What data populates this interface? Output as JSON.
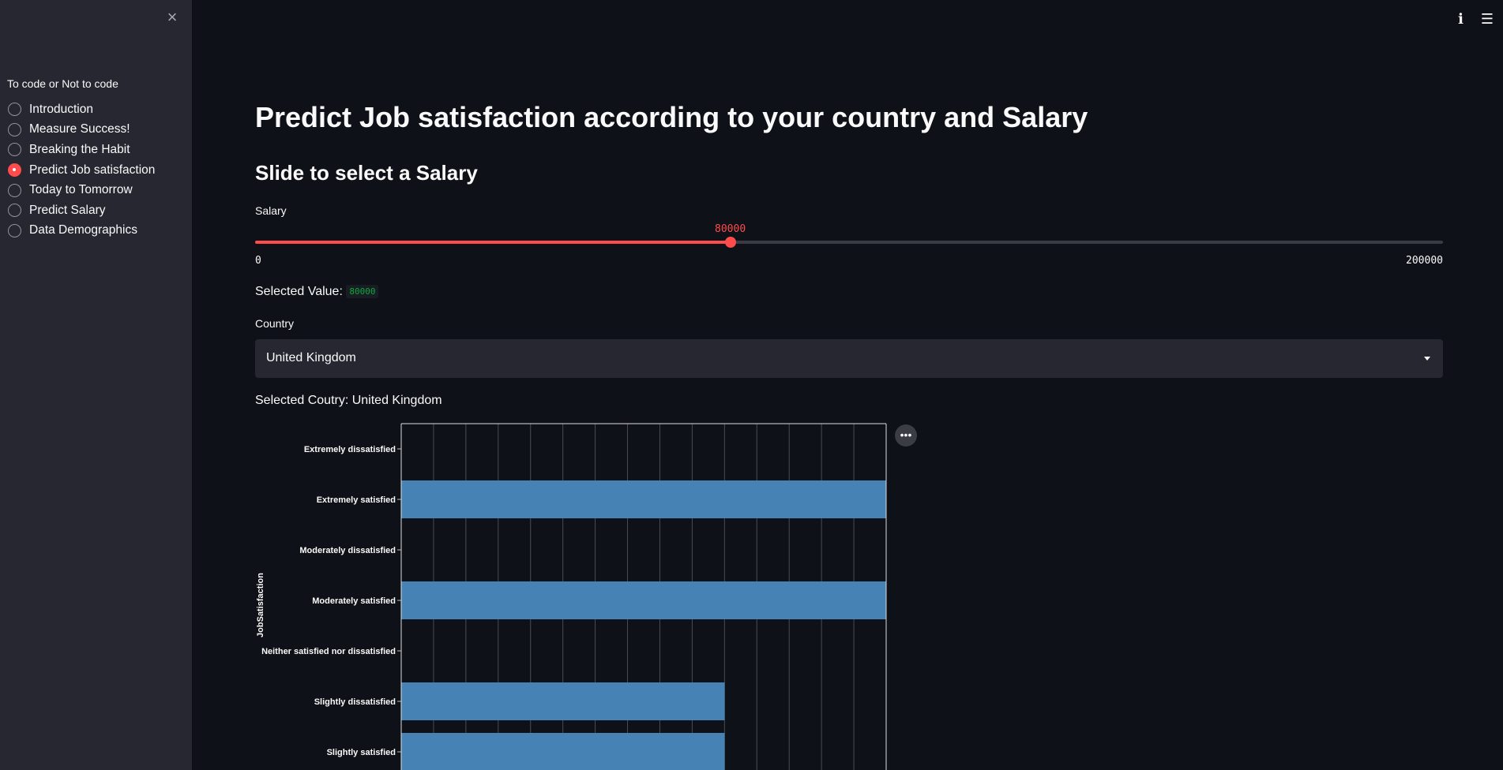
{
  "sidebar": {
    "close_label": "×",
    "radio_title": "To code or Not to code",
    "items": [
      {
        "label": "Introduction",
        "selected": false
      },
      {
        "label": "Measure Success!",
        "selected": false
      },
      {
        "label": "Breaking the Habit",
        "selected": false
      },
      {
        "label": "Predict Job satisfaction",
        "selected": true
      },
      {
        "label": "Today to Tomorrow",
        "selected": false
      },
      {
        "label": "Predict Salary",
        "selected": false
      },
      {
        "label": "Data Demographics",
        "selected": false
      }
    ]
  },
  "topbar": {
    "icons": [
      "info-icon",
      "hamburger-menu-icon"
    ]
  },
  "main": {
    "title": "Predict Job satisfaction according to your country and Salary",
    "subtitle": "Slide to select a Salary",
    "slider": {
      "label": "Salary",
      "value": 80000,
      "value_text": "80000",
      "min": 0,
      "max": 200000,
      "min_text": "0",
      "max_text": "200000"
    },
    "selected_value_label": "Selected Value:",
    "selected_value": "80000",
    "country_label": "Country",
    "country_value": "United Kingdom",
    "selected_country_text": "Selected Coutry: United Kingdom",
    "chart_menu_icon": "more-horizontal-icon"
  },
  "colors": {
    "accent": "#ff4b4b",
    "bar": "#4682b4",
    "sidebar_bg": "#262730",
    "page_bg": "#0e1117"
  },
  "chart_data": {
    "type": "bar",
    "orientation": "horizontal",
    "ylabel": "JobSatisfaction",
    "categories": [
      "Extremely dissatisfied",
      "Extremely satisfied",
      "Moderately dissatisfied",
      "Moderately satisfied",
      "Neither satisfied nor dissatisfied",
      "Slightly dissatisfied",
      "Slightly satisfied"
    ],
    "values": [
      0,
      1,
      0,
      1,
      0,
      0.667,
      0.667
    ],
    "xlim": [
      0,
      1
    ],
    "grid": true
  }
}
